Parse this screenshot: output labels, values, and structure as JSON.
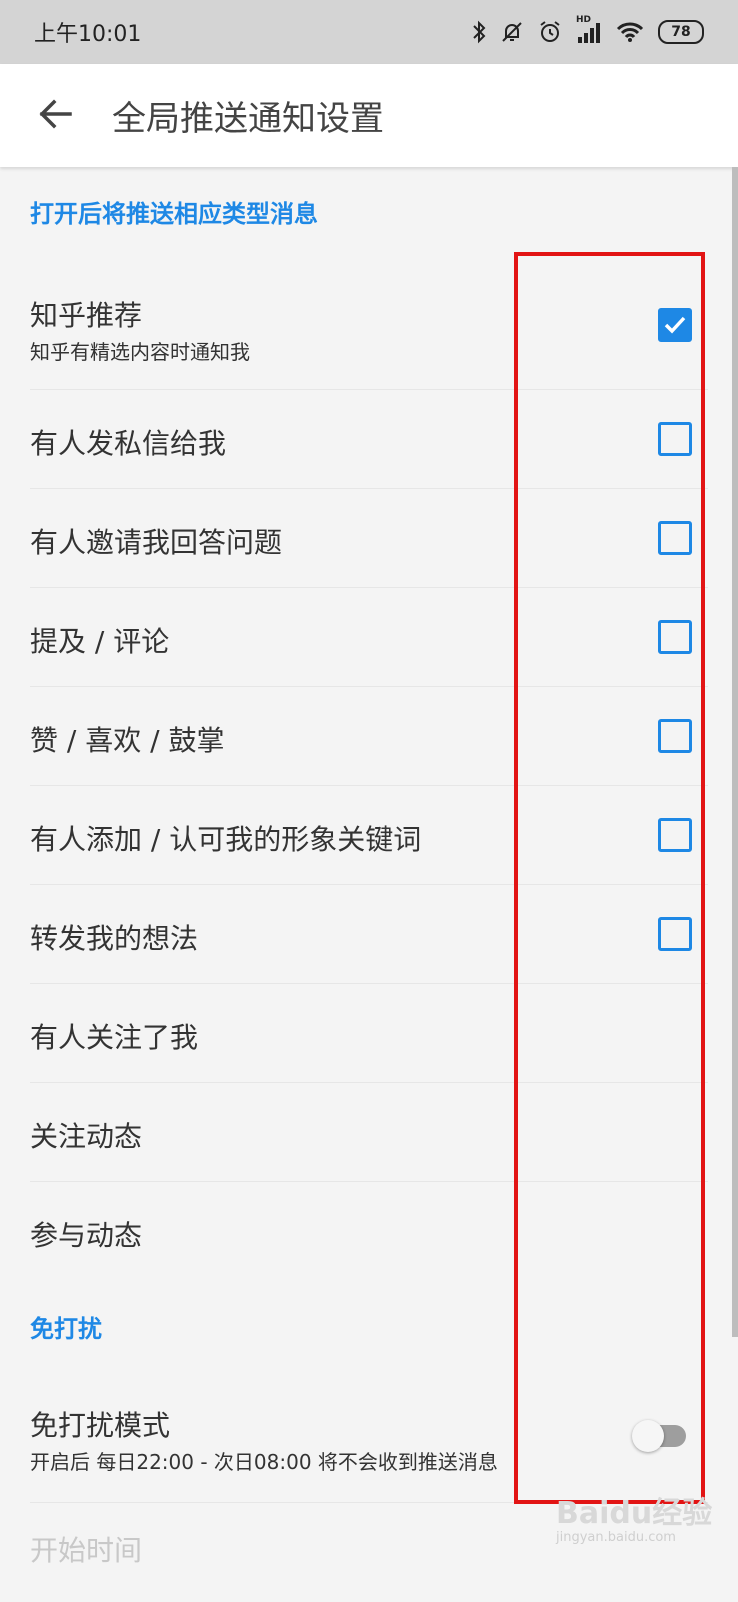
{
  "status_bar": {
    "time": "上午10:01",
    "battery": "78",
    "network_label": "HD"
  },
  "app_bar": {
    "title": "全局推送通知设置"
  },
  "sections": {
    "push_header": "打开后将推送相应类型消息",
    "dnd_header": "免打扰"
  },
  "push_items": [
    {
      "label": "知乎推荐",
      "sub": "知乎有精选内容时通知我",
      "checked": true
    },
    {
      "label": "有人发私信给我",
      "checked": false
    },
    {
      "label": "有人邀请我回答问题",
      "checked": false
    },
    {
      "label": "提及 / 评论",
      "checked": false
    },
    {
      "label": "赞 / 喜欢 / 鼓掌",
      "checked": false
    },
    {
      "label": "有人添加 / 认可我的形象关键词",
      "checked": false
    },
    {
      "label": "转发我的想法",
      "checked": false
    },
    {
      "label": "有人关注了我"
    },
    {
      "label": "关注动态"
    },
    {
      "label": "参与动态"
    }
  ],
  "dnd": {
    "label": "免打扰模式",
    "sub": "开启后 每日22:00 - 次日08:00 将不会收到推送消息",
    "enabled": false
  },
  "start_time_label": "开始时间",
  "watermark": {
    "text": "Baidu经验",
    "url_text": "jingyan.baidu.com"
  },
  "colors": {
    "accent": "#1e88e5",
    "highlight": "#e21414"
  }
}
